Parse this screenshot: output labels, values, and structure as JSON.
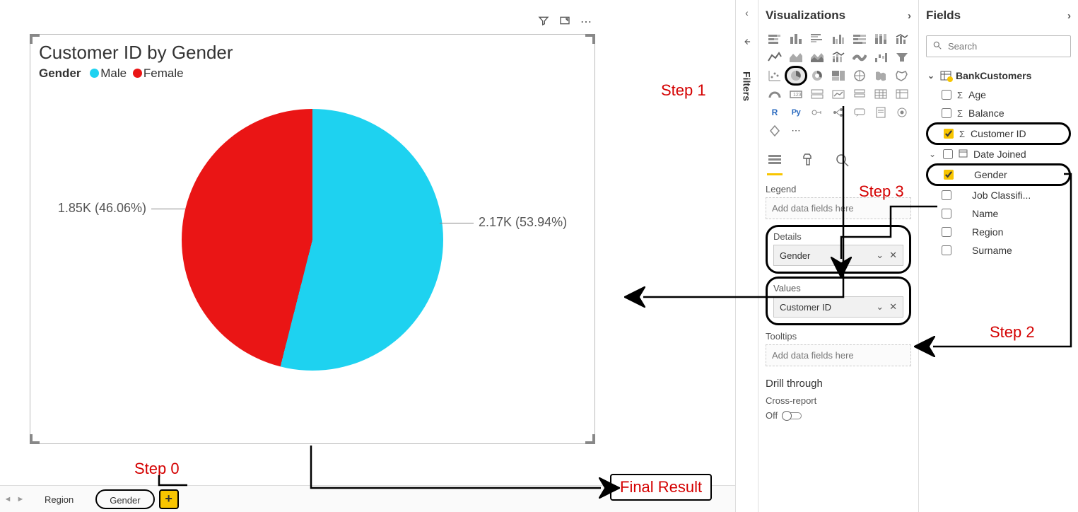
{
  "chart_data": {
    "type": "pie",
    "title": "Customer ID by Gender",
    "legend_title": "Gender",
    "series": [
      {
        "name": "Male",
        "value": 2170,
        "display": "2.17K",
        "percent": 53.94,
        "color": "#1ed2f0"
      },
      {
        "name": "Female",
        "value": 1850,
        "display": "1.85K",
        "percent": 46.06,
        "color": "#ea1515"
      }
    ]
  },
  "visual_header": {
    "filter_tip": "Filters on this visual",
    "focus_tip": "Focus mode",
    "more_tip": "More options"
  },
  "tabs": {
    "region": "Region",
    "gender": "Gender"
  },
  "filters_label": "Filters",
  "viz_pane": {
    "title": "Visualizations",
    "wells": {
      "legend": "Legend",
      "legend_placeholder": "Add data fields here",
      "details": "Details",
      "details_value": "Gender",
      "values": "Values",
      "values_value": "Customer ID",
      "tooltips": "Tooltips",
      "tooltips_placeholder": "Add data fields here"
    },
    "drill": {
      "heading": "Drill through",
      "cross": "Cross-report",
      "toggle": "Off"
    }
  },
  "fields_pane": {
    "title": "Fields",
    "search_placeholder": "Search",
    "table": "BankCustomers",
    "fields": {
      "age": "Age",
      "balance": "Balance",
      "customer_id": "Customer ID",
      "date_joined": "Date Joined",
      "gender": "Gender",
      "job": "Job Classifi...",
      "name": "Name",
      "region": "Region",
      "surname": "Surname"
    }
  },
  "annotations": {
    "step0": "Step 0",
    "step1": "Step 1",
    "step2": "Step 2",
    "step3": "Step 3",
    "final": "Final Result"
  }
}
